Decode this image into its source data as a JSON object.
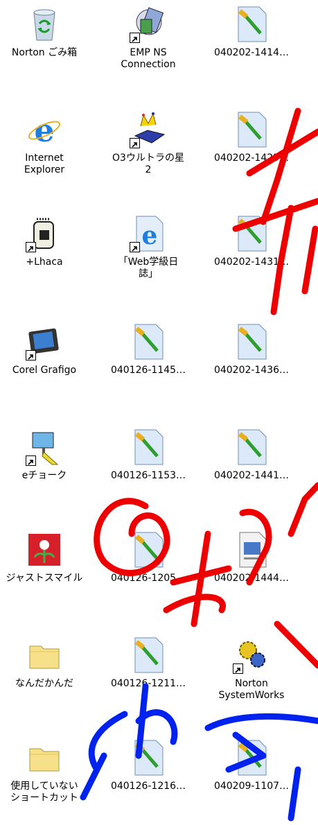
{
  "icons": [
    {
      "label": "Norton ごみ箱"
    },
    {
      "label": "EMP NS\nConnection"
    },
    {
      "label": "040202-1414…"
    },
    {
      "label": "Internet\nExplorer"
    },
    {
      "label": "O3ウルトラの星\n2"
    },
    {
      "label": "040202-1423…"
    },
    {
      "label": "+Lhaca"
    },
    {
      "label": "「Web学級日\n誌」"
    },
    {
      "label": "040202-1431…"
    },
    {
      "label": "Corel Grafigo"
    },
    {
      "label": "040126-1145…"
    },
    {
      "label": "040202-1436…"
    },
    {
      "label": "eチョーク"
    },
    {
      "label": "040126-1153…"
    },
    {
      "label": "040202-1441…"
    },
    {
      "label": "ジャストスマイル"
    },
    {
      "label": "040126-1205…"
    },
    {
      "label": "040202-1444…"
    },
    {
      "label": "なんだかんだ"
    },
    {
      "label": "040126-1211…"
    },
    {
      "label": "Norton\nSystemWorks"
    },
    {
      "label": "使用していない\nショートカット"
    },
    {
      "label": "040126-1216…"
    },
    {
      "label": "040209-1107…"
    }
  ],
  "colors": {
    "ink_red": "#ee0000",
    "ink_blue": "#0022ee"
  }
}
